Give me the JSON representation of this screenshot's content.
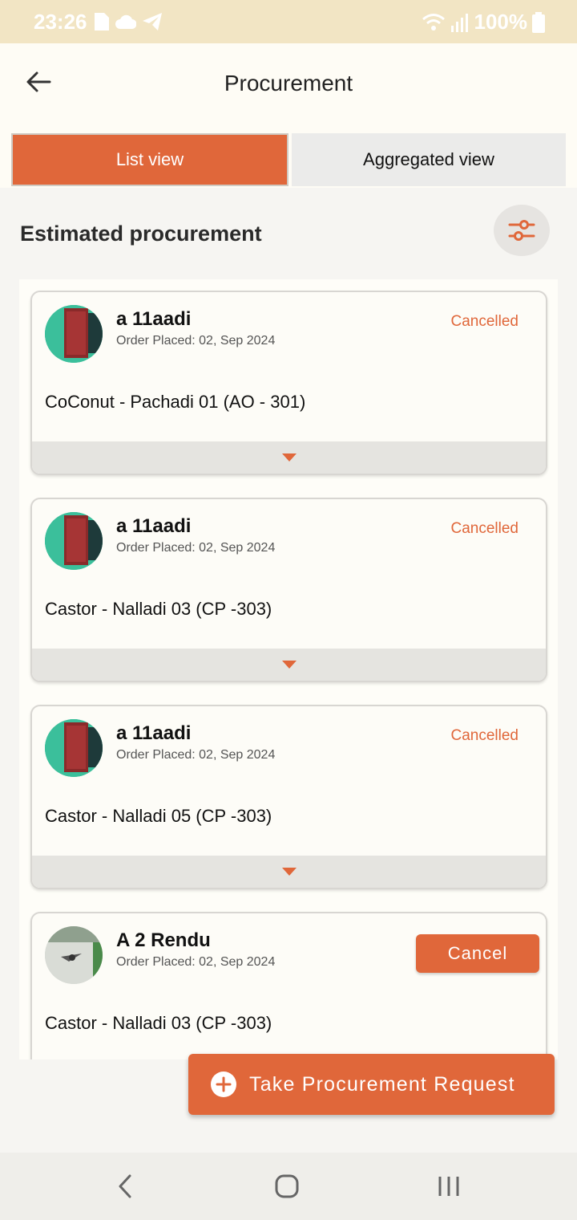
{
  "status_bar": {
    "time": "23:26",
    "battery": "100%",
    "icons": [
      "sim-card-icon",
      "cloud-icon",
      "telegram-icon",
      "wifi-icon",
      "signal-icon",
      "battery-icon"
    ]
  },
  "header": {
    "title": "Procurement",
    "back_icon": "arrow-left-icon"
  },
  "tabs": [
    {
      "label": "List view",
      "active": true
    },
    {
      "label": "Aggregated view",
      "active": false
    }
  ],
  "section": {
    "title": "Estimated procurement",
    "filter_icon": "sliders-icon"
  },
  "orders": [
    {
      "name": "a 11aadi",
      "date": "Order Placed: 02, Sep 2024",
      "status": "Cancelled",
      "product": "CoConut - Pachadi 01 (AO - 301)"
    },
    {
      "name": "a 11aadi",
      "date": "Order Placed: 02, Sep 2024",
      "status": "Cancelled",
      "product": "Castor - Nalladi 03 (CP -303)"
    },
    {
      "name": "a 11aadi",
      "date": "Order Placed: 02, Sep 2024",
      "status": "Cancelled",
      "product": "Castor - Nalladi 05 (CP -303)"
    },
    {
      "name": "A 2 Rendu",
      "date": "Order Placed: 02, Sep 2024",
      "action": "Cancel",
      "product": "Castor - Nalladi 03 (CP -303)"
    }
  ],
  "fab": {
    "label": "Take Procurement Request",
    "icon": "plus-circle-icon"
  },
  "nav": {
    "icons": [
      "nav-back-icon",
      "nav-home-icon",
      "nav-recents-icon"
    ]
  },
  "colors": {
    "accent": "#e0673a",
    "status_bar": "#f2e5c4",
    "header_bg": "#fefcf5"
  }
}
